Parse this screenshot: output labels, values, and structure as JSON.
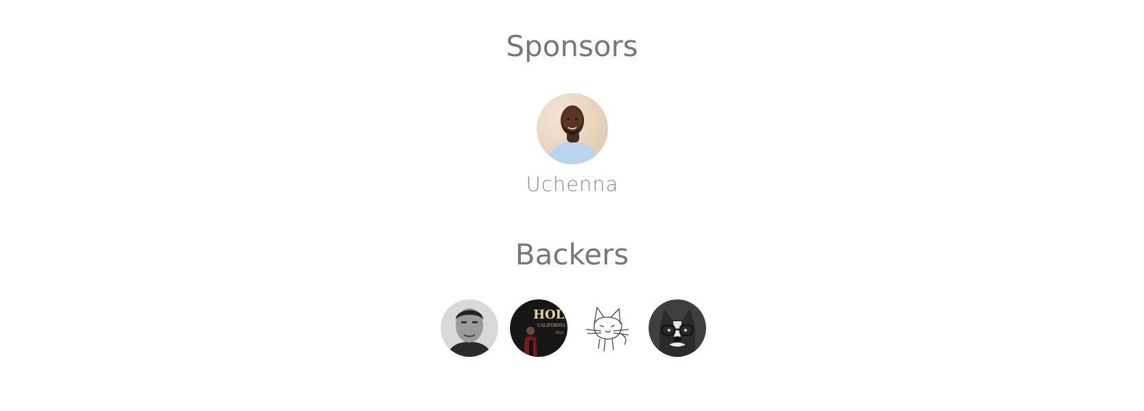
{
  "sections": {
    "sponsors_title": "Sponsors",
    "backers_title": "Backers"
  },
  "sponsors": [
    {
      "name": "Uchenna",
      "avatar_icon": "person-avatar-icon"
    }
  ],
  "backers": [
    {
      "avatar_icon": "man-grayscale-avatar-icon"
    },
    {
      "avatar_icon": "hollywood-sign-avatar-icon"
    },
    {
      "avatar_icon": "cat-sketch-avatar-icon"
    },
    {
      "avatar_icon": "dog-with-glasses-avatar-icon"
    }
  ],
  "colors": {
    "heading": "#777777",
    "name": "#8a8a8a",
    "background": "#ffffff"
  }
}
